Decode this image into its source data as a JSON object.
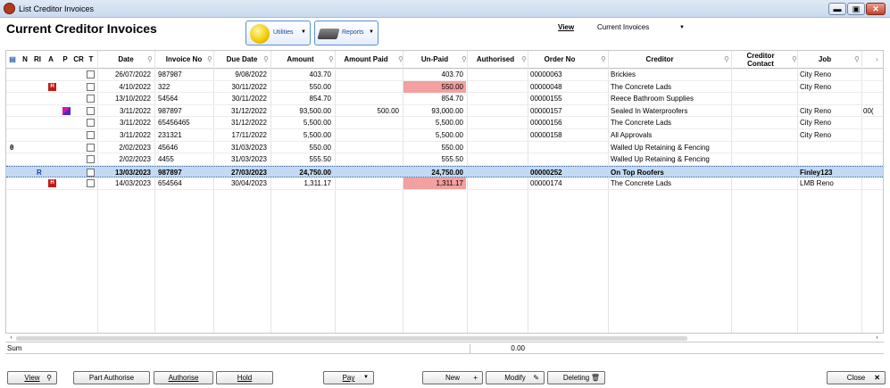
{
  "window": {
    "title": "List Creditor Invoices",
    "min_glyph": "▬",
    "max_glyph": "▣",
    "close_glyph": "✕"
  },
  "header": {
    "page_title": "Current Creditor Invoices",
    "utilities_label": "Utilities",
    "reports_label": "Reports",
    "view_label": "View",
    "view_value": "Current Invoices"
  },
  "columns": {
    "n": "N",
    "ri": "RI",
    "a": "A",
    "p": "P",
    "cr": "CR",
    "t": "T",
    "date": "Date",
    "invoice_no": "Invoice No",
    "due_date": "Due Date",
    "amount": "Amount",
    "amount_paid": "Amount Paid",
    "unpaid": "Un-Paid",
    "authorised": "Authorised",
    "order_no": "Order No",
    "creditor": "Creditor",
    "creditor_contact_1": "Creditor",
    "creditor_contact_2": "Contact",
    "job": "Job"
  },
  "rows": [
    {
      "date": "26/07/2022",
      "invoice_no": "987987",
      "due_date": "9/08/2022",
      "amount": "403.70",
      "amount_paid": "",
      "unpaid": "403.70",
      "order_no": "00000063",
      "creditor": "Brickies",
      "job": "City Reno",
      "extra": ""
    },
    {
      "date": "4/10/2022",
      "invoice_no": "322",
      "due_date": "30/11/2022",
      "amount": "550.00",
      "amount_paid": "",
      "unpaid": "550.00",
      "order_no": "00000048",
      "creditor": "The Concrete Lads",
      "job": "City Reno",
      "extra": ""
    },
    {
      "date": "13/10/2022",
      "invoice_no": "54564",
      "due_date": "30/11/2022",
      "amount": "854.70",
      "amount_paid": "",
      "unpaid": "854.70",
      "order_no": "00000155",
      "creditor": "Reece Bathroom Supplies",
      "job": "",
      "extra": ""
    },
    {
      "date": "3/11/2022",
      "invoice_no": "987897",
      "due_date": "31/12/2022",
      "amount": "93,500.00",
      "amount_paid": "500.00",
      "unpaid": "93,000.00",
      "order_no": "00000157",
      "creditor": "Sealed In Waterproofers",
      "job": "City Reno",
      "extra": "00("
    },
    {
      "date": "3/11/2022",
      "invoice_no": "65456465",
      "due_date": "31/12/2022",
      "amount": "5,500.00",
      "amount_paid": "",
      "unpaid": "5,500.00",
      "order_no": "00000156",
      "creditor": "The Concrete Lads",
      "job": "City Reno",
      "extra": ""
    },
    {
      "date": "3/11/2022",
      "invoice_no": "231321",
      "due_date": "17/11/2022",
      "amount": "5,500.00",
      "amount_paid": "",
      "unpaid": "5,500.00",
      "order_no": "00000158",
      "creditor": "All Approvals",
      "job": "City Reno",
      "extra": ""
    },
    {
      "date": "2/02/2023",
      "invoice_no": "45646",
      "due_date": "31/03/2023",
      "amount": "550.00",
      "amount_paid": "",
      "unpaid": "550.00",
      "order_no": "",
      "creditor": "Walled Up Retaining & Fencing",
      "job": "",
      "extra": ""
    },
    {
      "date": "2/02/2023",
      "invoice_no": "4455",
      "due_date": "31/03/2023",
      "amount": "555.50",
      "amount_paid": "",
      "unpaid": "555.50",
      "order_no": "",
      "creditor": "Walled Up Retaining & Fencing",
      "job": "",
      "extra": ""
    },
    {
      "date": "13/03/2023",
      "invoice_no": "987897",
      "due_date": "27/03/2023",
      "amount": "24,750.00",
      "amount_paid": "",
      "unpaid": "24,750.00",
      "order_no": "00000252",
      "creditor": "On Top Roofers",
      "job": "Finley123",
      "extra": ""
    },
    {
      "date": "14/03/2023",
      "invoice_no": "654564",
      "due_date": "30/04/2023",
      "amount": "1,311.17",
      "amount_paid": "",
      "unpaid": "1,311.17",
      "order_no": "00000174",
      "creditor": "The Concrete Lads",
      "job": "LMB Reno",
      "extra": ""
    }
  ],
  "flags": {
    "hold": "H",
    "ri": "R",
    "note": "θ"
  },
  "footer": {
    "sum_label": "Sum",
    "sum_value": "0.00"
  },
  "buttons": {
    "view": "View",
    "part_authorise": "Part Authorise",
    "authorise": "Authorise",
    "hold": "Hold",
    "pay": "Pay",
    "new": "New",
    "modify": "Modify",
    "deleting": "Deleting",
    "close": "Close"
  },
  "colors": {
    "accent": "#5a8fd6",
    "selected_row": "#c4daf4",
    "unpaid_highlight": "#f2a0a0",
    "hold_flag": "#c41a1a"
  }
}
